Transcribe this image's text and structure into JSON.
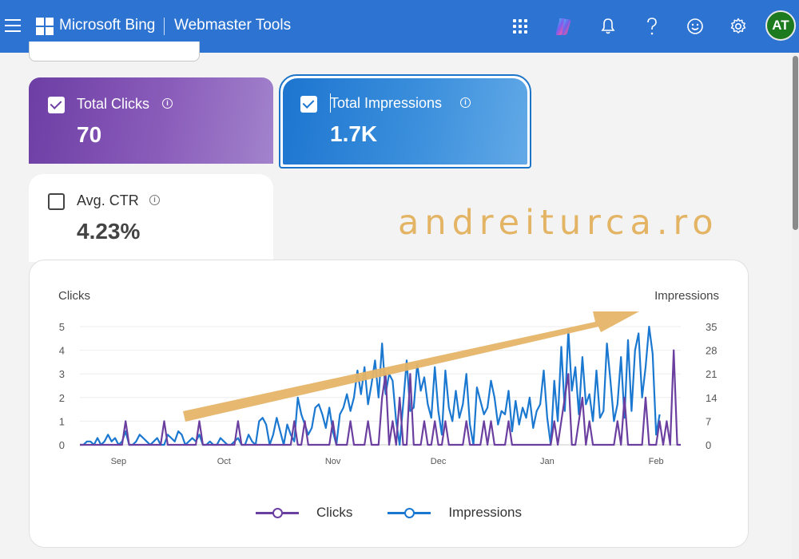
{
  "header": {
    "brand": "Microsoft Bing",
    "product": "Webmaster Tools",
    "avatar_initials": "AT",
    "icons": [
      "apps-grid-icon",
      "copilot-icon",
      "bell-icon",
      "help-icon",
      "smiley-icon",
      "gear-icon"
    ],
    "color": "#2d73d2"
  },
  "metrics": {
    "clicks": {
      "label": "Total Clicks",
      "value": "70",
      "checked": true,
      "color": "#6d3ea4"
    },
    "impressions": {
      "label": "Total Impressions",
      "value": "1.7K",
      "checked": true,
      "color": "#1d75cf"
    },
    "ctr": {
      "label": "Avg. CTR",
      "value": "4.23%",
      "checked": false
    }
  },
  "watermark": "andreiturca.ro",
  "legend": {
    "clicks": "Clicks",
    "impressions": "Impressions"
  },
  "chart_data": {
    "type": "line",
    "left_axis_label": "Clicks",
    "right_axis_label": "Impressions",
    "left_ticks": [
      "0",
      "1",
      "2",
      "3",
      "4",
      "5"
    ],
    "right_ticks": [
      "0",
      "7",
      "14",
      "21",
      "28",
      "35"
    ],
    "x_ticks": [
      "Sep",
      "Oct",
      "Nov",
      "Dec",
      "Jan",
      "Feb"
    ],
    "x_tick_day_index": [
      11,
      41,
      72,
      102,
      133,
      164
    ],
    "ylim_left": [
      0,
      5
    ],
    "ylim_right": [
      0,
      35
    ],
    "grid": true,
    "series": [
      {
        "name": "Clicks",
        "axis": "left",
        "color": "#6b3fa0",
        "values": [
          0,
          0,
          0,
          0,
          0,
          0,
          0,
          0,
          0,
          0,
          0,
          0,
          0,
          1,
          0,
          0,
          0,
          0,
          0,
          0,
          0,
          0,
          0,
          0,
          1,
          0,
          0,
          0,
          0,
          0,
          0,
          0,
          0,
          0,
          1,
          0,
          0,
          0,
          0,
          0,
          0,
          0,
          0,
          0,
          0,
          1,
          0,
          0,
          0,
          0,
          0,
          0,
          0,
          0,
          0,
          0,
          0,
          0,
          0,
          0,
          0,
          1,
          0,
          0,
          1,
          0,
          0,
          0,
          0,
          0,
          0,
          0,
          1,
          0,
          0,
          0,
          0,
          1,
          0,
          0,
          0,
          0,
          1,
          0,
          0,
          0,
          2,
          3,
          0,
          1,
          0,
          2,
          0,
          0,
          3,
          0,
          0,
          0,
          1,
          0,
          0,
          1,
          0,
          0,
          1,
          0,
          0,
          0,
          0,
          0,
          1,
          0,
          0,
          0,
          0,
          1,
          0,
          1,
          0,
          0,
          0,
          0,
          1,
          0,
          0,
          0,
          0,
          0,
          0,
          0,
          0,
          0,
          0,
          0,
          0,
          1,
          0,
          1,
          2,
          3,
          0,
          0,
          1,
          2,
          0,
          1,
          0,
          0,
          0,
          0,
          0,
          0,
          0,
          1,
          0,
          2,
          0,
          0,
          0,
          0,
          0,
          2,
          0,
          0,
          0,
          1,
          0,
          1,
          0,
          4,
          0,
          0
        ]
      },
      {
        "name": "Impressions",
        "axis": "right",
        "color": "#1b78d0",
        "values": [
          0,
          0,
          1,
          1,
          0,
          2,
          0,
          1,
          3,
          1,
          2,
          0,
          1,
          4,
          0,
          0,
          1,
          3,
          2,
          1,
          0,
          1,
          2,
          0,
          0,
          3,
          2,
          1,
          4,
          3,
          0,
          1,
          2,
          1,
          3,
          0,
          0,
          1,
          0,
          0,
          2,
          1,
          0,
          0,
          1,
          2,
          0,
          0,
          3,
          1,
          0,
          7,
          8,
          6,
          0,
          3,
          8,
          4,
          0,
          6,
          3,
          1,
          14,
          9,
          6,
          3,
          5,
          11,
          12,
          9,
          5,
          11,
          4,
          0,
          9,
          11,
          15,
          10,
          14,
          22,
          15,
          23,
          12,
          18,
          25,
          14,
          30,
          15,
          21,
          19,
          7,
          0,
          12,
          25,
          10,
          11,
          24,
          16,
          20,
          12,
          8,
          23,
          10,
          3,
          22,
          11,
          7,
          16,
          8,
          12,
          21,
          6,
          0,
          17,
          13,
          9,
          11,
          19,
          14,
          6,
          10,
          9,
          16,
          4,
          13,
          6,
          11,
          8,
          14,
          5,
          10,
          12,
          22,
          8,
          0,
          19,
          7,
          29,
          10,
          34,
          16,
          23,
          9,
          26,
          12,
          15,
          7,
          22,
          8,
          10,
          30,
          19,
          7,
          12,
          26,
          8,
          31,
          10,
          28,
          33,
          14,
          23,
          35,
          27,
          3,
          9
        ]
      }
    ]
  }
}
